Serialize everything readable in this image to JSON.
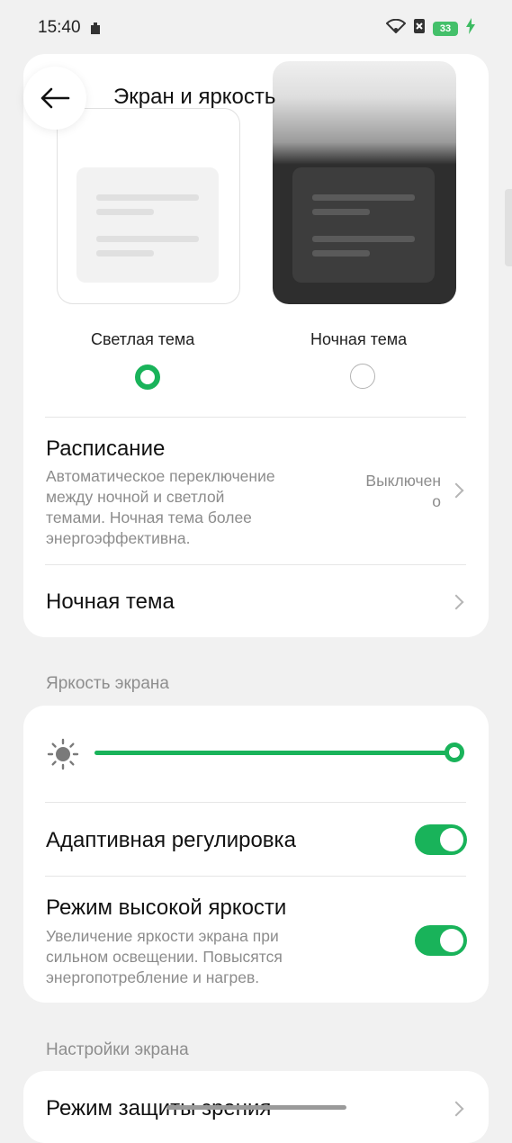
{
  "status_bar": {
    "time": "15:40",
    "battery": "33"
  },
  "header": {
    "title": "Экран и яркость"
  },
  "theme": {
    "light_label": "Светлая тема",
    "dark_label": "Ночная тема",
    "selected": "light"
  },
  "schedule": {
    "title": "Расписание",
    "description": [
      "Автоматическое переключение",
      "между ночной и светлой",
      "темами. Ночная тема более",
      "энергоэффективна."
    ],
    "value": [
      "Выключен",
      "о"
    ]
  },
  "night_theme": {
    "title": "Ночная тема"
  },
  "brightness": {
    "section_label": "Яркость экрана",
    "level": 1.0,
    "adaptive_title": "Адаптивная регулировка",
    "adaptive_on": true,
    "high_title": "Режим высокой яркости",
    "high_description": [
      "Увеличение яркости экрана при",
      "сильном освещении. Повысятся",
      "энергопотребление и нагрев."
    ],
    "high_on": true
  },
  "display_settings": {
    "section_label": "Настройки экрана",
    "eye_protection_title": "Режим защиты зрения"
  },
  "colors": {
    "accent": "#19b35a"
  }
}
